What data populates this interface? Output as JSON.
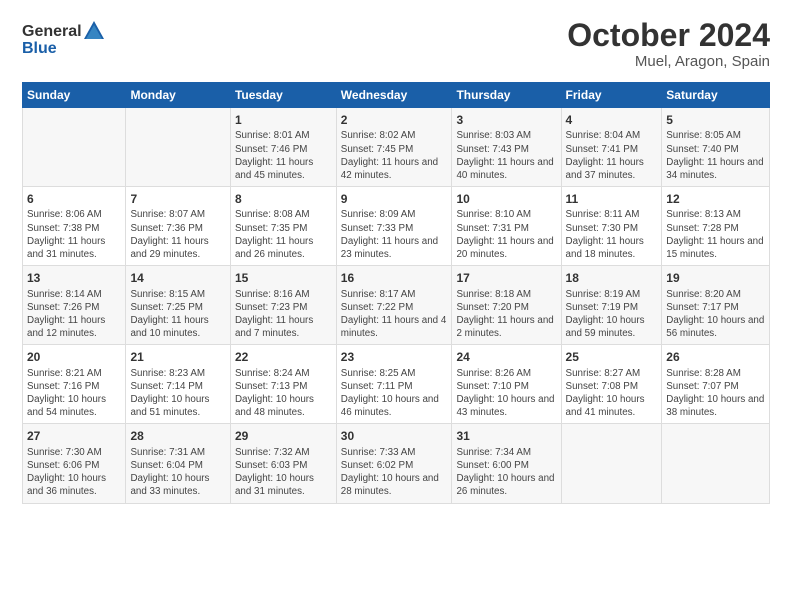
{
  "header": {
    "logo_general": "General",
    "logo_blue": "Blue",
    "month_title": "October 2024",
    "location": "Muel, Aragon, Spain"
  },
  "days_of_week": [
    "Sunday",
    "Monday",
    "Tuesday",
    "Wednesday",
    "Thursday",
    "Friday",
    "Saturday"
  ],
  "weeks": [
    [
      {
        "day": "",
        "info": ""
      },
      {
        "day": "",
        "info": ""
      },
      {
        "day": "1",
        "info": "Sunrise: 8:01 AM\nSunset: 7:46 PM\nDaylight: 11 hours and 45 minutes."
      },
      {
        "day": "2",
        "info": "Sunrise: 8:02 AM\nSunset: 7:45 PM\nDaylight: 11 hours and 42 minutes."
      },
      {
        "day": "3",
        "info": "Sunrise: 8:03 AM\nSunset: 7:43 PM\nDaylight: 11 hours and 40 minutes."
      },
      {
        "day": "4",
        "info": "Sunrise: 8:04 AM\nSunset: 7:41 PM\nDaylight: 11 hours and 37 minutes."
      },
      {
        "day": "5",
        "info": "Sunrise: 8:05 AM\nSunset: 7:40 PM\nDaylight: 11 hours and 34 minutes."
      }
    ],
    [
      {
        "day": "6",
        "info": "Sunrise: 8:06 AM\nSunset: 7:38 PM\nDaylight: 11 hours and 31 minutes."
      },
      {
        "day": "7",
        "info": "Sunrise: 8:07 AM\nSunset: 7:36 PM\nDaylight: 11 hours and 29 minutes."
      },
      {
        "day": "8",
        "info": "Sunrise: 8:08 AM\nSunset: 7:35 PM\nDaylight: 11 hours and 26 minutes."
      },
      {
        "day": "9",
        "info": "Sunrise: 8:09 AM\nSunset: 7:33 PM\nDaylight: 11 hours and 23 minutes."
      },
      {
        "day": "10",
        "info": "Sunrise: 8:10 AM\nSunset: 7:31 PM\nDaylight: 11 hours and 20 minutes."
      },
      {
        "day": "11",
        "info": "Sunrise: 8:11 AM\nSunset: 7:30 PM\nDaylight: 11 hours and 18 minutes."
      },
      {
        "day": "12",
        "info": "Sunrise: 8:13 AM\nSunset: 7:28 PM\nDaylight: 11 hours and 15 minutes."
      }
    ],
    [
      {
        "day": "13",
        "info": "Sunrise: 8:14 AM\nSunset: 7:26 PM\nDaylight: 11 hours and 12 minutes."
      },
      {
        "day": "14",
        "info": "Sunrise: 8:15 AM\nSunset: 7:25 PM\nDaylight: 11 hours and 10 minutes."
      },
      {
        "day": "15",
        "info": "Sunrise: 8:16 AM\nSunset: 7:23 PM\nDaylight: 11 hours and 7 minutes."
      },
      {
        "day": "16",
        "info": "Sunrise: 8:17 AM\nSunset: 7:22 PM\nDaylight: 11 hours and 4 minutes."
      },
      {
        "day": "17",
        "info": "Sunrise: 8:18 AM\nSunset: 7:20 PM\nDaylight: 11 hours and 2 minutes."
      },
      {
        "day": "18",
        "info": "Sunrise: 8:19 AM\nSunset: 7:19 PM\nDaylight: 10 hours and 59 minutes."
      },
      {
        "day": "19",
        "info": "Sunrise: 8:20 AM\nSunset: 7:17 PM\nDaylight: 10 hours and 56 minutes."
      }
    ],
    [
      {
        "day": "20",
        "info": "Sunrise: 8:21 AM\nSunset: 7:16 PM\nDaylight: 10 hours and 54 minutes."
      },
      {
        "day": "21",
        "info": "Sunrise: 8:23 AM\nSunset: 7:14 PM\nDaylight: 10 hours and 51 minutes."
      },
      {
        "day": "22",
        "info": "Sunrise: 8:24 AM\nSunset: 7:13 PM\nDaylight: 10 hours and 48 minutes."
      },
      {
        "day": "23",
        "info": "Sunrise: 8:25 AM\nSunset: 7:11 PM\nDaylight: 10 hours and 46 minutes."
      },
      {
        "day": "24",
        "info": "Sunrise: 8:26 AM\nSunset: 7:10 PM\nDaylight: 10 hours and 43 minutes."
      },
      {
        "day": "25",
        "info": "Sunrise: 8:27 AM\nSunset: 7:08 PM\nDaylight: 10 hours and 41 minutes."
      },
      {
        "day": "26",
        "info": "Sunrise: 8:28 AM\nSunset: 7:07 PM\nDaylight: 10 hours and 38 minutes."
      }
    ],
    [
      {
        "day": "27",
        "info": "Sunrise: 7:30 AM\nSunset: 6:06 PM\nDaylight: 10 hours and 36 minutes."
      },
      {
        "day": "28",
        "info": "Sunrise: 7:31 AM\nSunset: 6:04 PM\nDaylight: 10 hours and 33 minutes."
      },
      {
        "day": "29",
        "info": "Sunrise: 7:32 AM\nSunset: 6:03 PM\nDaylight: 10 hours and 31 minutes."
      },
      {
        "day": "30",
        "info": "Sunrise: 7:33 AM\nSunset: 6:02 PM\nDaylight: 10 hours and 28 minutes."
      },
      {
        "day": "31",
        "info": "Sunrise: 7:34 AM\nSunset: 6:00 PM\nDaylight: 10 hours and 26 minutes."
      },
      {
        "day": "",
        "info": ""
      },
      {
        "day": "",
        "info": ""
      }
    ]
  ]
}
